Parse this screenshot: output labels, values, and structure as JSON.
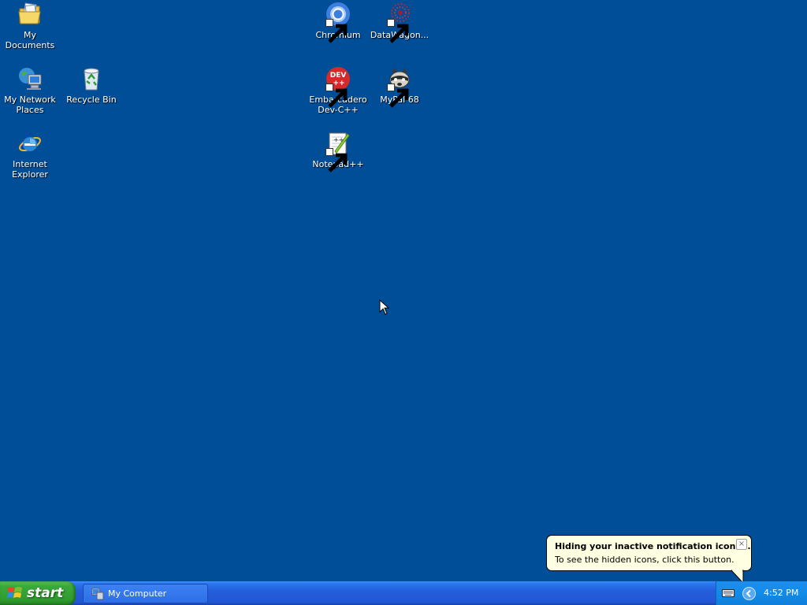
{
  "desktop": {
    "background_color": "#004e98",
    "icons": [
      {
        "name": "my-documents",
        "label": "My Documents",
        "icon": "folder-documents-icon"
      },
      {
        "name": "my-network-places",
        "label": "My Network\nPlaces",
        "icon": "network-places-icon"
      },
      {
        "name": "recycle-bin",
        "label": "Recycle Bin",
        "icon": "recycle-bin-icon"
      },
      {
        "name": "internet-explorer",
        "label": "Internet\nExplorer",
        "icon": "internet-explorer-icon"
      },
      {
        "name": "chromium",
        "label": "Chromium",
        "icon": "chromium-icon",
        "shortcut": true
      },
      {
        "name": "datawagon",
        "label": "DataWagon...",
        "icon": "datawagon-icon",
        "shortcut": true
      },
      {
        "name": "embarcadero-devcpp",
        "label": "Embarcadero\nDev-C++",
        "icon": "devcpp-icon",
        "shortcut": true
      },
      {
        "name": "mypal",
        "label": "MyPal 68",
        "icon": "mypal-raccoon-icon",
        "shortcut": true
      },
      {
        "name": "notepadpp",
        "label": "Notepad++",
        "icon": "notepadpp-icon",
        "shortcut": true
      }
    ]
  },
  "balloon": {
    "title": "Hiding your inactive notification icons...",
    "text": "To see the hidden icons, click this button.",
    "close_label": "×"
  },
  "taskbar": {
    "start_label": "start",
    "tasks": [
      {
        "label": "My Computer",
        "icon": "my-computer-icon"
      }
    ],
    "clock": "4:52 PM",
    "tray_icons": [
      "keyboard-icon",
      "show-hidden-icons-chevron-icon"
    ],
    "colors": {
      "start_green": "#3aa93a",
      "taskbar_blue": "#245edb",
      "tray_blue": "#128be8",
      "balloon_bg": "#ffffe1"
    }
  }
}
